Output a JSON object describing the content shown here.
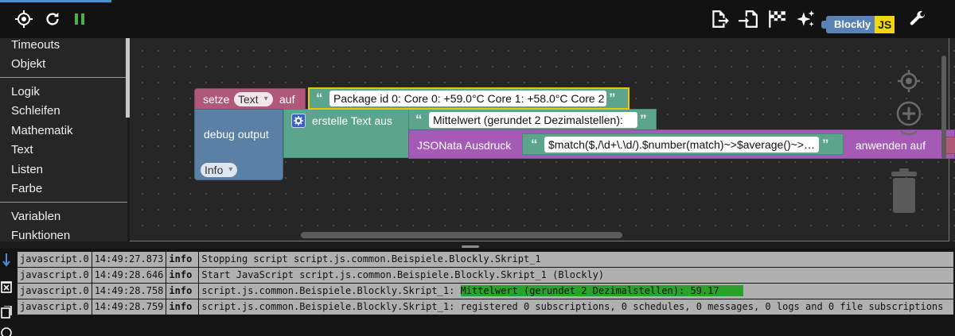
{
  "sidebar": {
    "categories": [
      {
        "label": "Timeouts"
      },
      {
        "label": "Objekt"
      },
      {
        "label": "Logik"
      },
      {
        "label": "Schleifen"
      },
      {
        "label": "Mathematik"
      },
      {
        "label": "Text"
      },
      {
        "label": "Listen"
      },
      {
        "label": "Farbe"
      },
      {
        "label": "Variablen"
      },
      {
        "label": "Funktionen"
      }
    ]
  },
  "toolbar": {
    "left_icons": [
      "crosshair-icon",
      "refresh-icon",
      "pause-icon"
    ],
    "right_icons": [
      "export-icon",
      "import-icon",
      "checkered-flag-icon",
      "sparkle-icon",
      "wrench-icon"
    ],
    "badge_text": "Blockly",
    "badge_js": "JS",
    "colors": {
      "pause": "#4caf50",
      "badge_blue": "#5a82b4",
      "badge_yellow": "#f0d80e"
    }
  },
  "blocks": {
    "setze_label": "setze",
    "variable": "Text",
    "auf_label": "auf",
    "package_text": "Package id 0: Core 0: +59.0°C Core 1: +58.0°C Core 2",
    "debug_label": "debug output",
    "level": "Info",
    "erstelle_label": "erstelle Text aus",
    "mittelwert_text": "Mittelwert (gerundet 2 Dezimalstellen):",
    "jsonata_label": "JSONata Ausdruck",
    "jsonata_expr": "$match($,/\\d+\\.\\d/).$number(match)~>$average()~>…",
    "anwenden_label": "anwenden auf",
    "quote_open": "“",
    "quote_close": "”",
    "colors": {
      "variables": "#b05877",
      "debug": "#5b80a5",
      "text": "#5ba58c",
      "jsonata": "#a55bb5",
      "selected_border": "#f0c400"
    }
  },
  "log": {
    "rows": [
      {
        "source": "javascript.0",
        "time": "14:49:27.873",
        "severity": "info",
        "message": "Stopping script script.js.common.Beispiele.Blockly.Skript_1",
        "highlight": ""
      },
      {
        "source": "javascript.0",
        "time": "14:49:28.646",
        "severity": "info",
        "message": "Start JavaScript script.js.common.Beispiele.Blockly.Skript_1 (Blockly)",
        "highlight": ""
      },
      {
        "source": "javascript.0",
        "time": "14:49:28.758",
        "severity": "info",
        "message": "script.js.common.Beispiele.Blockly.Skript_1: ",
        "highlight": "Mittelwert (gerundet 2 Dezimalstellen): 59.17"
      },
      {
        "source": "javascript.0",
        "time": "14:49:28.759",
        "severity": "info",
        "message": "script.js.common.Beispiele.Blockly.Skript_1: registered 0 subscriptions, 0 schedules, 0 messages, 0 logs and 0 file subscriptions",
        "highlight": ""
      }
    ],
    "side_icons": [
      "scroll-down-icon",
      "clear-log-icon",
      "copy-icon"
    ],
    "highlight_color": "#2aa12a"
  }
}
